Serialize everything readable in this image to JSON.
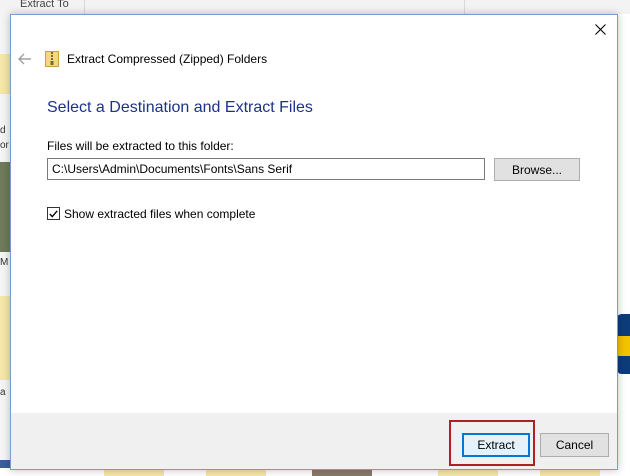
{
  "background_window": {
    "tab_label": "Extract To",
    "left_fragments": [
      "d",
      "or",
      "M",
      "a"
    ]
  },
  "dialog": {
    "title": "Extract Compressed (Zipped) Folders",
    "heading": "Select a Destination and Extract Files",
    "path_label": "Files will be extracted to this folder:",
    "path_value": "C:\\Users\\Admin\\Documents\\Fonts\\Sans Serif",
    "browse_label": "Browse...",
    "checkbox_label": "Show extracted files when complete",
    "checkbox_checked": true,
    "extract_label": "Extract",
    "cancel_label": "Cancel",
    "icons": {
      "close": "close-icon",
      "back": "back-arrow-icon",
      "zip": "zip-folder-icon"
    }
  },
  "colors": {
    "heading": "#1e3287",
    "highlight": "#b11f24",
    "primary_border": "#0078d7"
  }
}
